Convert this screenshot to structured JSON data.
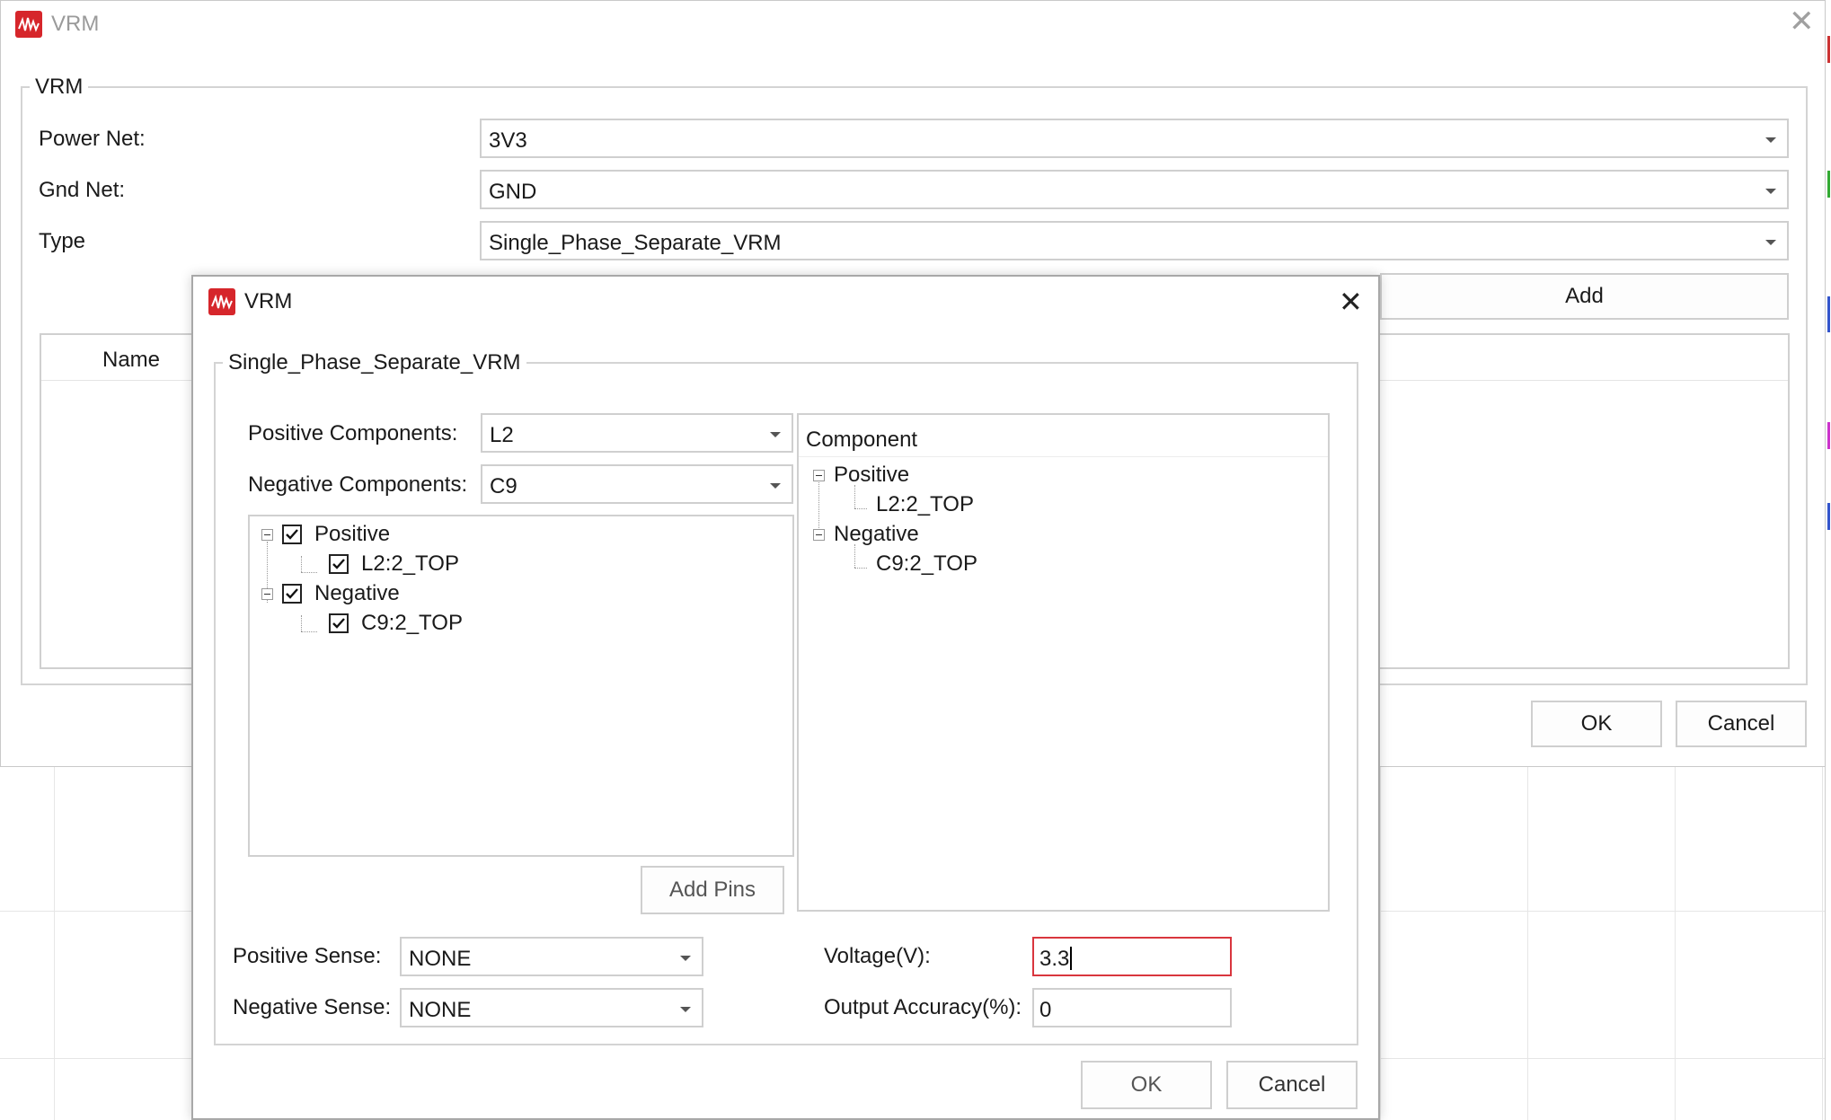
{
  "outer_window": {
    "title": "VRM",
    "group_label": "VRM",
    "power_net_label": "Power Net:",
    "power_net_value": "3V3",
    "gnd_net_label": "Gnd Net:",
    "gnd_net_value": "GND",
    "type_label": "Type",
    "type_value": "Single_Phase_Separate_VRM",
    "add_button": "Add",
    "table_col_name": "Name",
    "ok_button": "OK",
    "cancel_button": "Cancel"
  },
  "inner_dialog": {
    "title": "VRM",
    "group_label": "Single_Phase_Separate_VRM",
    "positive_components_label": "Positive Components:",
    "positive_components_value": "L2",
    "negative_components_label": "Negative Components:",
    "negative_components_value": "C9",
    "pin_tree": {
      "positive_label": "Positive",
      "positive_child": "L2:2_TOP",
      "negative_label": "Negative",
      "negative_child": "C9:2_TOP"
    },
    "add_pins_button": "Add Pins",
    "component_tree": {
      "header": "Component",
      "positive_label": "Positive",
      "positive_child": "L2:2_TOP",
      "negative_label": "Negative",
      "negative_child": "C9:2_TOP"
    },
    "positive_sense_label": "Positive Sense:",
    "positive_sense_value": "NONE",
    "negative_sense_label": "Negative Sense:",
    "negative_sense_value": "NONE",
    "voltage_label": "Voltage(V):",
    "voltage_value": "3.3",
    "output_accuracy_label": "Output Accuracy(%):",
    "output_accuracy_value": "0",
    "ok_button": "OK",
    "cancel_button": "Cancel"
  },
  "colors": {
    "logo_red": "#d6262b",
    "active_field_border": "#d9363e"
  },
  "icons": [
    "app-logo-icon",
    "close-icon",
    "dropdown-arrow-icon",
    "tree-expander-icon",
    "checkbox-checked-icon"
  ]
}
